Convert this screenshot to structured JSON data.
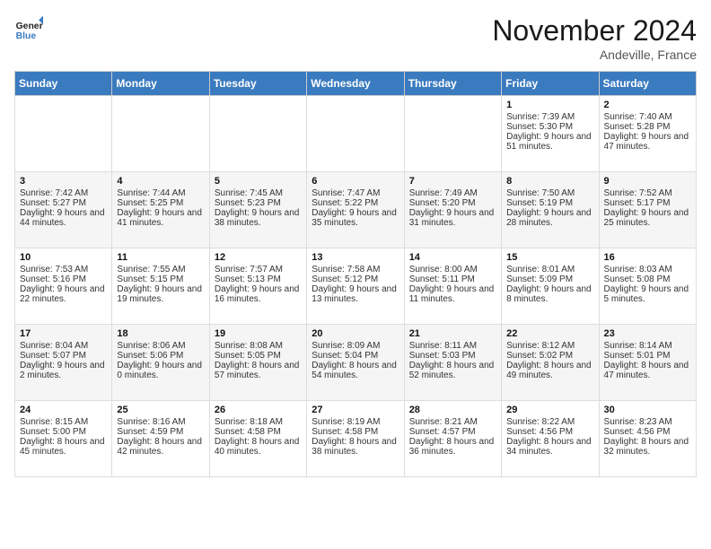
{
  "header": {
    "logo_general": "General",
    "logo_blue": "Blue",
    "month": "November 2024",
    "location": "Andeville, France"
  },
  "weekdays": [
    "Sunday",
    "Monday",
    "Tuesday",
    "Wednesday",
    "Thursday",
    "Friday",
    "Saturday"
  ],
  "weeks": [
    [
      {
        "day": "",
        "sunrise": "",
        "sunset": "",
        "daylight": ""
      },
      {
        "day": "",
        "sunrise": "",
        "sunset": "",
        "daylight": ""
      },
      {
        "day": "",
        "sunrise": "",
        "sunset": "",
        "daylight": ""
      },
      {
        "day": "",
        "sunrise": "",
        "sunset": "",
        "daylight": ""
      },
      {
        "day": "",
        "sunrise": "",
        "sunset": "",
        "daylight": ""
      },
      {
        "day": "1",
        "sunrise": "Sunrise: 7:39 AM",
        "sunset": "Sunset: 5:30 PM",
        "daylight": "Daylight: 9 hours and 51 minutes."
      },
      {
        "day": "2",
        "sunrise": "Sunrise: 7:40 AM",
        "sunset": "Sunset: 5:28 PM",
        "daylight": "Daylight: 9 hours and 47 minutes."
      }
    ],
    [
      {
        "day": "3",
        "sunrise": "Sunrise: 7:42 AM",
        "sunset": "Sunset: 5:27 PM",
        "daylight": "Daylight: 9 hours and 44 minutes."
      },
      {
        "day": "4",
        "sunrise": "Sunrise: 7:44 AM",
        "sunset": "Sunset: 5:25 PM",
        "daylight": "Daylight: 9 hours and 41 minutes."
      },
      {
        "day": "5",
        "sunrise": "Sunrise: 7:45 AM",
        "sunset": "Sunset: 5:23 PM",
        "daylight": "Daylight: 9 hours and 38 minutes."
      },
      {
        "day": "6",
        "sunrise": "Sunrise: 7:47 AM",
        "sunset": "Sunset: 5:22 PM",
        "daylight": "Daylight: 9 hours and 35 minutes."
      },
      {
        "day": "7",
        "sunrise": "Sunrise: 7:49 AM",
        "sunset": "Sunset: 5:20 PM",
        "daylight": "Daylight: 9 hours and 31 minutes."
      },
      {
        "day": "8",
        "sunrise": "Sunrise: 7:50 AM",
        "sunset": "Sunset: 5:19 PM",
        "daylight": "Daylight: 9 hours and 28 minutes."
      },
      {
        "day": "9",
        "sunrise": "Sunrise: 7:52 AM",
        "sunset": "Sunset: 5:17 PM",
        "daylight": "Daylight: 9 hours and 25 minutes."
      }
    ],
    [
      {
        "day": "10",
        "sunrise": "Sunrise: 7:53 AM",
        "sunset": "Sunset: 5:16 PM",
        "daylight": "Daylight: 9 hours and 22 minutes."
      },
      {
        "day": "11",
        "sunrise": "Sunrise: 7:55 AM",
        "sunset": "Sunset: 5:15 PM",
        "daylight": "Daylight: 9 hours and 19 minutes."
      },
      {
        "day": "12",
        "sunrise": "Sunrise: 7:57 AM",
        "sunset": "Sunset: 5:13 PM",
        "daylight": "Daylight: 9 hours and 16 minutes."
      },
      {
        "day": "13",
        "sunrise": "Sunrise: 7:58 AM",
        "sunset": "Sunset: 5:12 PM",
        "daylight": "Daylight: 9 hours and 13 minutes."
      },
      {
        "day": "14",
        "sunrise": "Sunrise: 8:00 AM",
        "sunset": "Sunset: 5:11 PM",
        "daylight": "Daylight: 9 hours and 11 minutes."
      },
      {
        "day": "15",
        "sunrise": "Sunrise: 8:01 AM",
        "sunset": "Sunset: 5:09 PM",
        "daylight": "Daylight: 9 hours and 8 minutes."
      },
      {
        "day": "16",
        "sunrise": "Sunrise: 8:03 AM",
        "sunset": "Sunset: 5:08 PM",
        "daylight": "Daylight: 9 hours and 5 minutes."
      }
    ],
    [
      {
        "day": "17",
        "sunrise": "Sunrise: 8:04 AM",
        "sunset": "Sunset: 5:07 PM",
        "daylight": "Daylight: 9 hours and 2 minutes."
      },
      {
        "day": "18",
        "sunrise": "Sunrise: 8:06 AM",
        "sunset": "Sunset: 5:06 PM",
        "daylight": "Daylight: 9 hours and 0 minutes."
      },
      {
        "day": "19",
        "sunrise": "Sunrise: 8:08 AM",
        "sunset": "Sunset: 5:05 PM",
        "daylight": "Daylight: 8 hours and 57 minutes."
      },
      {
        "day": "20",
        "sunrise": "Sunrise: 8:09 AM",
        "sunset": "Sunset: 5:04 PM",
        "daylight": "Daylight: 8 hours and 54 minutes."
      },
      {
        "day": "21",
        "sunrise": "Sunrise: 8:11 AM",
        "sunset": "Sunset: 5:03 PM",
        "daylight": "Daylight: 8 hours and 52 minutes."
      },
      {
        "day": "22",
        "sunrise": "Sunrise: 8:12 AM",
        "sunset": "Sunset: 5:02 PM",
        "daylight": "Daylight: 8 hours and 49 minutes."
      },
      {
        "day": "23",
        "sunrise": "Sunrise: 8:14 AM",
        "sunset": "Sunset: 5:01 PM",
        "daylight": "Daylight: 8 hours and 47 minutes."
      }
    ],
    [
      {
        "day": "24",
        "sunrise": "Sunrise: 8:15 AM",
        "sunset": "Sunset: 5:00 PM",
        "daylight": "Daylight: 8 hours and 45 minutes."
      },
      {
        "day": "25",
        "sunrise": "Sunrise: 8:16 AM",
        "sunset": "Sunset: 4:59 PM",
        "daylight": "Daylight: 8 hours and 42 minutes."
      },
      {
        "day": "26",
        "sunrise": "Sunrise: 8:18 AM",
        "sunset": "Sunset: 4:58 PM",
        "daylight": "Daylight: 8 hours and 40 minutes."
      },
      {
        "day": "27",
        "sunrise": "Sunrise: 8:19 AM",
        "sunset": "Sunset: 4:58 PM",
        "daylight": "Daylight: 8 hours and 38 minutes."
      },
      {
        "day": "28",
        "sunrise": "Sunrise: 8:21 AM",
        "sunset": "Sunset: 4:57 PM",
        "daylight": "Daylight: 8 hours and 36 minutes."
      },
      {
        "day": "29",
        "sunrise": "Sunrise: 8:22 AM",
        "sunset": "Sunset: 4:56 PM",
        "daylight": "Daylight: 8 hours and 34 minutes."
      },
      {
        "day": "30",
        "sunrise": "Sunrise: 8:23 AM",
        "sunset": "Sunset: 4:56 PM",
        "daylight": "Daylight: 8 hours and 32 minutes."
      }
    ]
  ]
}
